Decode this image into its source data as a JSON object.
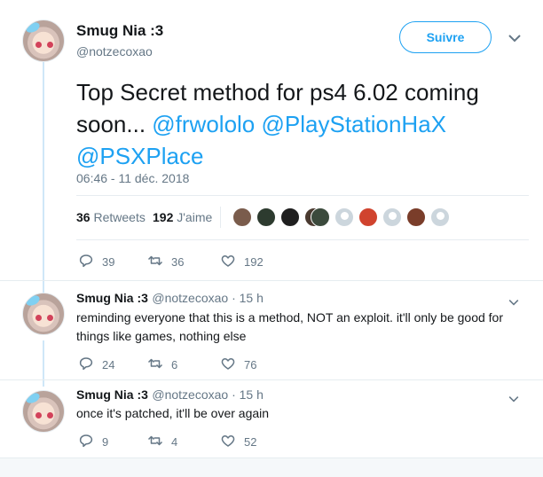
{
  "main_tweet": {
    "display_name": "Smug Nia :3",
    "handle": "@notzecoxao",
    "follow_label": "Suivre",
    "text_plain": "Top Secret method for ps4 6.02 coming soon... ",
    "mentions": [
      "@frwololo",
      "@PlayStationHaX",
      "@PSXPlace"
    ],
    "timestamp": "06:46 - 11 déc. 2018",
    "retweets_count": "36",
    "retweets_label": "Retweets",
    "likes_count": "192",
    "likes_label": "J'aime",
    "actions": {
      "reply": "39",
      "retweet": "36",
      "like": "192"
    }
  },
  "replies": [
    {
      "display_name": "Smug Nia :3",
      "meta": "@notzecoxao · 15 h",
      "text": "reminding everyone that this is a method, NOT an exploit. it'll only be good for things like games, nothing else",
      "actions": {
        "reply": "24",
        "retweet": "6",
        "like": "76"
      }
    },
    {
      "display_name": "Smug Nia :3",
      "meta": "@notzecoxao · 15 h",
      "text": "once it's patched, it'll be over again",
      "actions": {
        "reply": "9",
        "retweet": "4",
        "like": "52"
      }
    }
  ],
  "icons": {
    "reply": "reply-icon",
    "retweet": "retweet-icon",
    "like": "heart-icon",
    "more": "chevron-down-icon"
  },
  "colors": {
    "accent": "#1da1f2",
    "muted": "#657786",
    "thread": "#cfe7f8"
  }
}
